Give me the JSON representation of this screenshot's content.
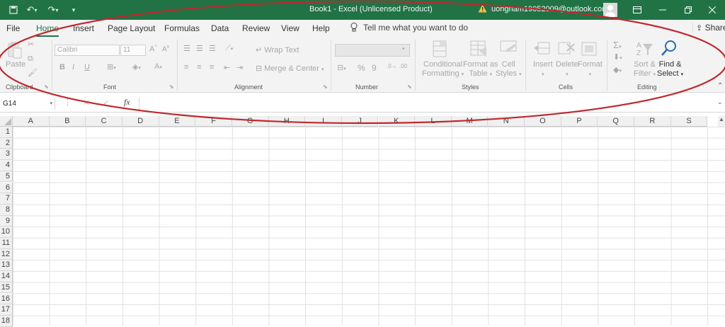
{
  "window": {
    "title": "Book1  -  Excel (Unlicensed Product)",
    "account": "uongnam19052009@outlook.com",
    "colors": {
      "brand": "#217346",
      "annotation": "#c0282d"
    }
  },
  "quick_access": {
    "icons": [
      "save-icon",
      "undo-icon",
      "redo-icon",
      "customize-icon"
    ]
  },
  "tabs": [
    "File",
    "Home",
    "Insert",
    "Page Layout",
    "Formulas",
    "Data",
    "Review",
    "View",
    "Help"
  ],
  "active_tab": "Home",
  "tell_me": "Tell me what you want to do",
  "share": "Share",
  "ribbon": {
    "clipboard": {
      "label": "Clipboard",
      "paste": "Paste"
    },
    "font": {
      "label": "Font",
      "name": "Calibri",
      "size": "11",
      "bold": "B",
      "italic": "I",
      "underline": "U"
    },
    "alignment": {
      "label": "Alignment",
      "wrap": "Wrap Text",
      "merge": "Merge & Center"
    },
    "number": {
      "label": "Number",
      "percent": "%",
      "comma": "9"
    },
    "styles": {
      "label": "Styles",
      "cond1": "Conditional",
      "cond2": "Formatting",
      "fmt1": "Format as",
      "fmt2": "Table",
      "cell1": "Cell",
      "cell2": "Styles"
    },
    "cells": {
      "label": "Cells",
      "insert": "Insert",
      "delete": "Delete",
      "format": "Format"
    },
    "editing": {
      "label": "Editing",
      "sort1": "Sort &",
      "sort2": "Filter",
      "find1": "Find &",
      "find2": "Select"
    }
  },
  "formula_bar": {
    "namebox": "G14",
    "fx": "fx",
    "value": ""
  },
  "sheet": {
    "columns": [
      "A",
      "B",
      "C",
      "D",
      "E",
      "F",
      "G",
      "H",
      "I",
      "J",
      "K",
      "L",
      "M",
      "N",
      "O",
      "P",
      "Q",
      "R",
      "S"
    ],
    "rows": [
      "1",
      "2",
      "3",
      "4",
      "5",
      "6",
      "7",
      "8",
      "9",
      "10",
      "11",
      "12",
      "13",
      "14",
      "15",
      "16",
      "17",
      "18"
    ]
  }
}
